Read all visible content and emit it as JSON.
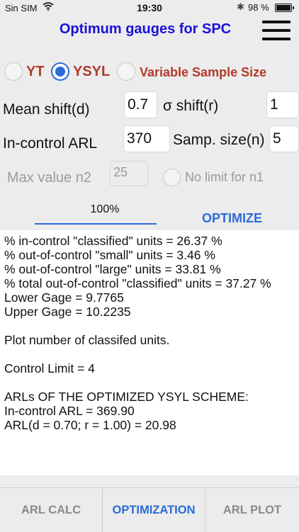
{
  "status_bar": {
    "carrier": "Sin SIM",
    "time": "19:30",
    "battery": "98 %",
    "icons": [
      "wifi-icon",
      "bluetooth-icon",
      "battery-icon"
    ]
  },
  "header": {
    "title": "Optimum gauges for SPC",
    "menu_icon": "hamburger-menu-icon"
  },
  "scheme_options": [
    {
      "label": "YT",
      "selected": false
    },
    {
      "label": "YSYL",
      "selected": true
    },
    {
      "label": "Variable Sample Size",
      "selected": false
    }
  ],
  "inputs": {
    "mean_shift": {
      "label": "Mean shift(d)",
      "value": "0.7"
    },
    "sigma_shift": {
      "label": "σ shift(r)",
      "value": "1"
    },
    "in_control_arl": {
      "label": "In-control ARL",
      "value": "370"
    },
    "sample_size": {
      "label": "Samp. size(n)",
      "value": "5"
    },
    "max_n2": {
      "label": "Max value n2",
      "placeholder": "25"
    },
    "no_limit_n1": {
      "label": "No limit for n1"
    }
  },
  "progress": {
    "label": "100%",
    "fraction": 1.0
  },
  "optimize_label": "OPTIMIZE",
  "results": [
    "% in-control \"classified\" units = 26.37 %",
    "% out-of-control \"small\" units = 3.46 %",
    "% out-of-control \"large\" units = 33.81 %",
    "% total out-of-control \"classified\" units = 37.27 %",
    "Lower Gage = 9.7765",
    "Upper Gage = 10.2235",
    "",
    "Plot number of classifed units.",
    "",
    "Control Limit  = 4",
    "",
    "ARLs OF THE OPTIMIZED YSYL SCHEME:",
    "In-control ARL = 369.90",
    "ARL(d = 0.70; r = 1.00) = 20.98",
    ""
  ],
  "tabs": [
    {
      "label": "ARL CALC",
      "active": false
    },
    {
      "label": "OPTIMIZATION",
      "active": true
    },
    {
      "label": "ARL PLOT",
      "active": false
    }
  ],
  "colors": {
    "title": "#1a10d8",
    "accent": "#2a6bd9",
    "option_label": "#b23a2a",
    "background": "#ececec"
  }
}
